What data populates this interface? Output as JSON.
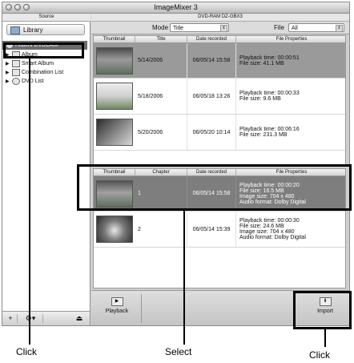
{
  "window": {
    "title": "ImageMixer 3"
  },
  "sidebar": {
    "header": "Source",
    "library_label": "Library",
    "items": [
      {
        "label": "Hitachi DVDCAM",
        "selected": true,
        "icon": "disc-icon"
      },
      {
        "label": "Album",
        "icon": "album-icon"
      },
      {
        "label": "Smart Album",
        "icon": "smart-album-icon"
      },
      {
        "label": "Combination List",
        "icon": "combination-icon"
      },
      {
        "label": "DVD List",
        "icon": "dvd-icon"
      }
    ],
    "bottom_buttons": [
      "+",
      "⚙▾",
      "⏏"
    ]
  },
  "main": {
    "drive_label": "DVD-RAM DZ-GBX3",
    "mode_label": "Mode",
    "mode_value": "Title",
    "file_label": "File",
    "file_value": "All"
  },
  "titles_table": {
    "columns": [
      "Thumbnail",
      "Title",
      "Date recorded",
      "File Properties"
    ],
    "rows": [
      {
        "title": "5/14/2006",
        "date": "06/05/14 15:58",
        "props": [
          "Playback time: 00:00:51",
          "File size: 41.1 MB"
        ]
      },
      {
        "title": "5/18/2006",
        "date": "06/05/18 13:26",
        "props": [
          "Playback time: 00:00:33",
          "File size: 9.6 MB"
        ]
      },
      {
        "title": "5/20/2006",
        "date": "06/05/20 10:14",
        "props": [
          "Playback time: 00:06:16",
          "File size: 231.3 MB"
        ]
      }
    ]
  },
  "chapters_table": {
    "columns": [
      "Thumbnail",
      "Chapter",
      "Date recorded",
      "File Properties"
    ],
    "rows": [
      {
        "chapter": "1",
        "date": "06/05/14 15:58",
        "props": [
          "Playback time: 00:00:20",
          "File size: 16.5 MB",
          "Image size: 704 x 480",
          "Audio format: Dolby Digital"
        ]
      },
      {
        "chapter": "2",
        "date": "06/05/14 15:39",
        "props": [
          "Playback time: 00:00:30",
          "File size: 24.6 MB",
          "Image size: 704 x 480",
          "Audio format: Dolby Digital"
        ]
      }
    ]
  },
  "toolbar": {
    "playback_label": "Playback",
    "import_label": "Import"
  },
  "annotations": {
    "left": "Click",
    "middle": "Select",
    "right": "Click"
  }
}
